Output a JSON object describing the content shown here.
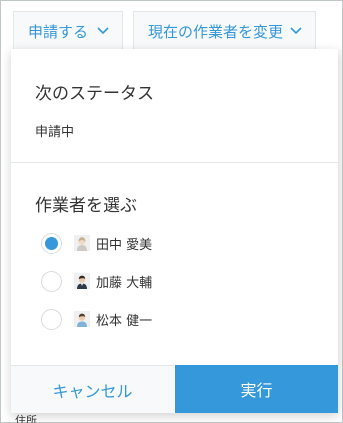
{
  "toolbar": {
    "apply_label": "申請する",
    "change_assignee_label": "現在の作業者を変更"
  },
  "dialog": {
    "next_status_title": "次のステータス",
    "next_status_value": "申請中",
    "select_assignee_title": "作業者を選ぶ",
    "assignees": [
      {
        "name": "田中 愛美",
        "selected": true
      },
      {
        "name": "加藤 大輔",
        "selected": false
      },
      {
        "name": "松本 健一",
        "selected": false
      }
    ],
    "cancel_label": "キャンセル",
    "execute_label": "実行"
  },
  "background": {
    "partial_text": "住所"
  },
  "colors": {
    "accent": "#3498db",
    "border": "#e3e7e8",
    "muted_bg": "#f7f9fa",
    "text": "#333333"
  }
}
